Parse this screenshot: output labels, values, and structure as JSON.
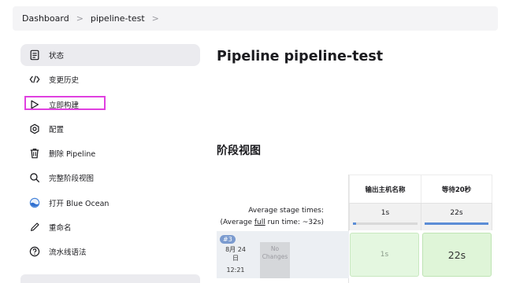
{
  "breadcrumb": {
    "items": [
      "Dashboard",
      "pipeline-test"
    ],
    "separator": ">"
  },
  "sidebar": {
    "items": [
      {
        "label": "状态",
        "icon": "status-icon",
        "active": true
      },
      {
        "label": "变更历史",
        "icon": "code-icon"
      },
      {
        "label": "立即构建",
        "icon": "play-icon",
        "highlighted": true
      },
      {
        "label": "配置",
        "icon": "gear-icon"
      },
      {
        "label": "删除 Pipeline",
        "icon": "trash-icon"
      },
      {
        "label": "完整阶段视图",
        "icon": "search-icon"
      },
      {
        "label": "打开 Blue Ocean",
        "icon": "blue-ocean-icon"
      },
      {
        "label": "重命名",
        "icon": "pencil-icon"
      },
      {
        "label": "流水线语法",
        "icon": "help-icon"
      }
    ]
  },
  "main": {
    "title": "Pipeline pipeline-test",
    "stage_view_title": "阶段视图"
  },
  "stage_view": {
    "avg_label_line1": "Average stage times:",
    "avg_label_prefix": "(Average ",
    "avg_label_link": "full",
    "avg_label_suffix": " run time: ~32s)",
    "stages": [
      {
        "name": "输出主机名称",
        "avg": "1s",
        "avg_fraction": 0.05,
        "cell": "1s"
      },
      {
        "name": "等待20秒",
        "avg": "22s",
        "avg_fraction": 1.0,
        "cell": "22s"
      }
    ],
    "run": {
      "badge": "#3",
      "date_line1": "8月 24",
      "date_line2": "日",
      "time": "12:21",
      "changes_line1": "No",
      "changes_line2": "Changes"
    }
  },
  "colors": {
    "highlight": "#e040e0",
    "success": "#dff5d8",
    "progress": "#5b8dd6"
  }
}
